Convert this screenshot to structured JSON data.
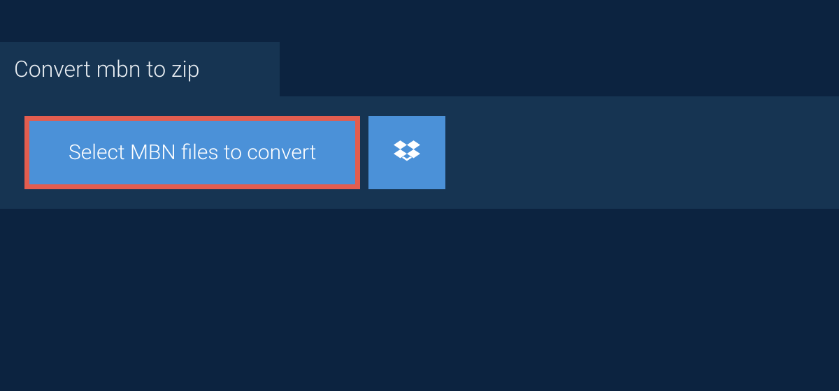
{
  "tab": {
    "label": "Convert mbn to zip"
  },
  "actions": {
    "select_label": "Select MBN files to convert"
  },
  "colors": {
    "page_bg": "#0c2340",
    "panel_bg": "#163452",
    "button_bg": "#4b91d8",
    "highlight_border": "#e35d4f",
    "text_light": "#ffffff"
  }
}
